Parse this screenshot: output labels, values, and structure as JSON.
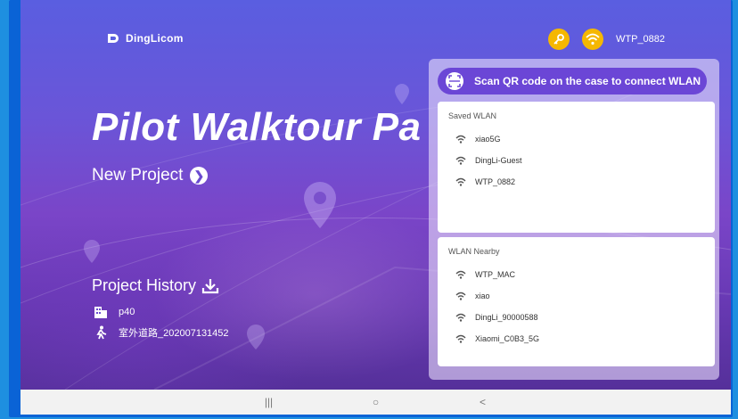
{
  "app": {
    "logo_text": "DingLicom",
    "title": "Pilot Walktour Pa",
    "new_project_label": "New Project",
    "history_label": "Project History"
  },
  "history": [
    {
      "label": "p40",
      "icon": "building-icon"
    },
    {
      "label": "室外道路_202007131452",
      "icon": "walking-person-icon"
    }
  ],
  "status": {
    "ssid": "WTP_0882",
    "key_icon": "key-icon",
    "wifi_icon": "wifi-icon",
    "accent": "#f5b700"
  },
  "wlan_panel": {
    "scan_label": "Scan QR code on the case to connect WLAN",
    "saved_header": "Saved WLAN",
    "saved": [
      "xiao5G",
      "DingLi-Guest",
      "WTP_0882"
    ],
    "nearby_header": "WLAN Nearby",
    "nearby": [
      "WTP_MAC",
      "xiao",
      "DingLi_90000588",
      "Xiaomi_C0B3_5G"
    ]
  },
  "system_nav": {
    "recents": "|||",
    "home": "○",
    "back": "<"
  },
  "colors": {
    "primary": "#6b46d6",
    "frame": "#0a63d6"
  }
}
